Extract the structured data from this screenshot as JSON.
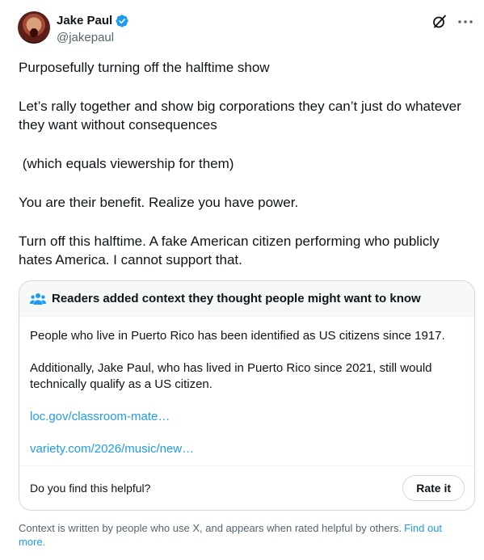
{
  "author": {
    "display_name": "Jake Paul",
    "handle": "@jakepaul",
    "verified_color": "#1d9bf0"
  },
  "icons": {
    "verified": "verified-badge-icon",
    "grok": "grok-icon",
    "more": "more-options-icon",
    "readers": "people-icon"
  },
  "tweet": {
    "paragraphs": [
      "Purposefully turning off the halftime show",
      "Let’s rally together and show big corporations they can’t just do whatever they want without consequences",
      " (which equals viewership for them)",
      "You are their benefit. Realize you have power.",
      "Turn off this halftime. A fake American citizen performing who publicly hates America. I cannot support that."
    ]
  },
  "community_note": {
    "title": "Readers added context they thought people might want to know",
    "paragraphs": [
      "People who live in Puerto Rico has been identified as US citizens since 1917.",
      "Additionally, Jake Paul, who has lived in Puerto Rico since 2021, still would technically qualify as a US citizen."
    ],
    "links": [
      "loc.gov/classroom-mate…",
      "variety.com/2026/music/new…"
    ],
    "helpful_question": "Do you find this helpful?",
    "rate_button": "Rate it"
  },
  "footer": {
    "context_text": "Context is written by people who use X, and appears when rated helpful by others.",
    "find_out_more": "Find out more."
  },
  "colors": {
    "link": "#1d9bf0",
    "secondary_text": "#536471",
    "border": "#cfd9de"
  }
}
